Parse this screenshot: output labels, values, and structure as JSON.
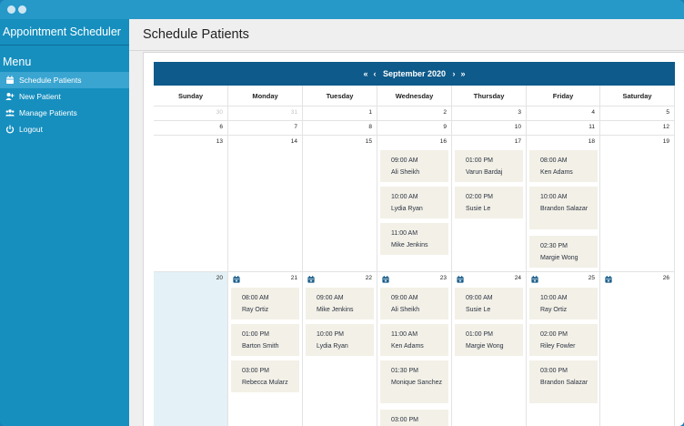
{
  "app": {
    "title": "Appointment Scheduler"
  },
  "sidebar": {
    "menu_heading": "Menu",
    "items": [
      {
        "label": "Schedule Patients",
        "icon": "calendar-icon",
        "active": true
      },
      {
        "label": "New Patient",
        "icon": "add-user-icon",
        "active": false
      },
      {
        "label": "Manage Patients",
        "icon": "users-icon",
        "active": false
      },
      {
        "label": "Logout",
        "icon": "power-icon",
        "active": false
      }
    ]
  },
  "page": {
    "title": "Schedule Patients"
  },
  "calendar": {
    "month_label": "September 2020",
    "nav": {
      "prev_year": "«",
      "prev_month": "‹",
      "next_month": "›",
      "next_year": "»"
    },
    "weekdays": [
      "Sunday",
      "Monday",
      "Tuesday",
      "Wednesday",
      "Thursday",
      "Friday",
      "Saturday"
    ],
    "weeks": [
      [
        "30",
        "31",
        "1",
        "2",
        "3",
        "4",
        "5"
      ],
      [
        "6",
        "7",
        "8",
        "9",
        "10",
        "11",
        "12"
      ],
      [
        "13",
        "14",
        "15",
        "16",
        "17",
        "18",
        "19"
      ],
      [
        "20",
        "21",
        "22",
        "23",
        "24",
        "25",
        "26"
      ]
    ],
    "appointments": {
      "16": [
        {
          "time": "09:00 AM",
          "patient": "Ali Sheikh"
        },
        {
          "time": "10:00 AM",
          "patient": "Lydia Ryan"
        },
        {
          "time": "11:00 AM",
          "patient": "Mike Jenkins"
        }
      ],
      "17": [
        {
          "time": "01:00 PM",
          "patient": "Varun Bardaj"
        },
        {
          "time": "02:00 PM",
          "patient": "Susie Le"
        }
      ],
      "18": [
        {
          "time": "08:00 AM",
          "patient": "Ken Adams"
        },
        {
          "time": "10:00 AM",
          "patient": "Brandon Salazar"
        },
        {
          "time": "02:30 PM",
          "patient": "Margie Wong"
        }
      ],
      "21": [
        {
          "time": "08:00 AM",
          "patient": "Ray Ortiz"
        },
        {
          "time": "01:00 PM",
          "patient": "Barton Smith"
        },
        {
          "time": "03:00 PM",
          "patient": "Rebecca Mularz"
        }
      ],
      "22": [
        {
          "time": "09:00 AM",
          "patient": "Mike Jenkins"
        },
        {
          "time": "10:00 PM",
          "patient": "Lydia Ryan"
        }
      ],
      "23": [
        {
          "time": "09:00 AM",
          "patient": "Ali Sheikh"
        },
        {
          "time": "11:00 AM",
          "patient": "Ken Adams"
        },
        {
          "time": "01:30 PM",
          "patient": "Monique Sanchez"
        },
        {
          "time": "03:00 PM",
          "patient": ""
        }
      ],
      "24": [
        {
          "time": "09:00 AM",
          "patient": "Susie Le"
        },
        {
          "time": "01:00 PM",
          "patient": "Margie Wong"
        }
      ],
      "25": [
        {
          "time": "10:00 AM",
          "patient": "Ray Ortiz"
        },
        {
          "time": "02:00 PM",
          "patient": "Riley Fowler"
        },
        {
          "time": "03:00 PM",
          "patient": "Brandon Salazar"
        }
      ]
    },
    "schedule_icon_days": [
      "21",
      "22",
      "23",
      "24",
      "25",
      "26"
    ],
    "today": "20",
    "colors": {
      "header": "#0e5a8a",
      "today": "#e4f1f6",
      "appointment": "#f3f0e7",
      "sidebar": "#168fbf",
      "active_item": "#3aa5d1"
    }
  }
}
